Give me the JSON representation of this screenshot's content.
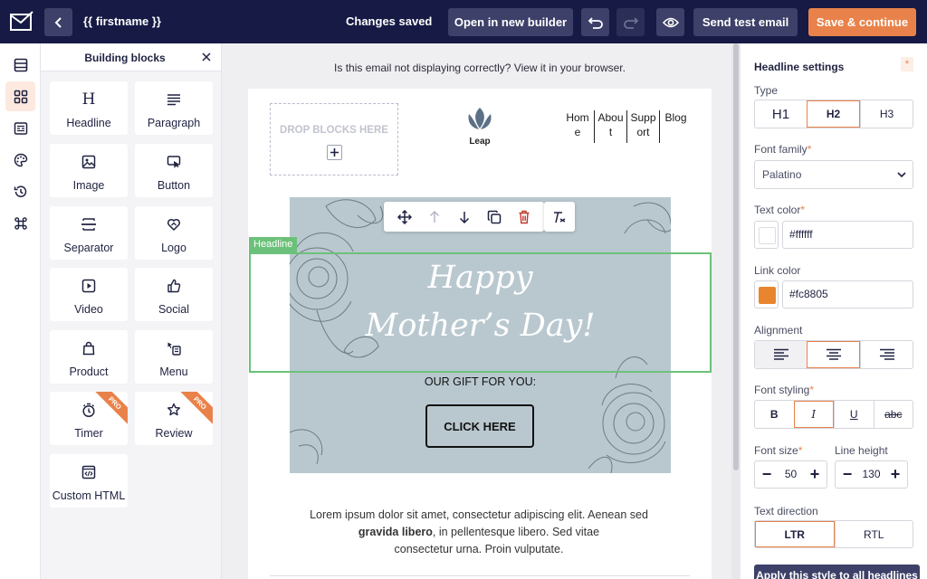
{
  "header": {
    "email_name": "{{ firstname }}",
    "status": "Changes saved",
    "open_builder": "Open in new builder",
    "send_test": "Send test email",
    "save_continue": "Save & continue"
  },
  "blocks_panel": {
    "title": "Building blocks",
    "items": [
      {
        "label": "Headline",
        "icon": "headline-icon"
      },
      {
        "label": "Paragraph",
        "icon": "paragraph-icon"
      },
      {
        "label": "Image",
        "icon": "image-icon"
      },
      {
        "label": "Button",
        "icon": "button-icon"
      },
      {
        "label": "Separator",
        "icon": "separator-icon"
      },
      {
        "label": "Logo",
        "icon": "logo-icon"
      },
      {
        "label": "Video",
        "icon": "video-icon"
      },
      {
        "label": "Social",
        "icon": "social-icon"
      },
      {
        "label": "Product",
        "icon": "product-icon"
      },
      {
        "label": "Menu",
        "icon": "menu-icon"
      },
      {
        "label": "Timer",
        "icon": "timer-icon",
        "badge": "PRO"
      },
      {
        "label": "Review",
        "icon": "review-icon",
        "badge": "PRO"
      },
      {
        "label": "Custom HTML",
        "icon": "code-icon"
      }
    ]
  },
  "canvas": {
    "browser_note": "Is this email not displaying correctly? View it in your browser.",
    "drop_text": "DROP BLOCKS HERE",
    "logo_text": "Leap",
    "nav": [
      "Home",
      "About",
      "Support",
      "Blog"
    ],
    "selection_tag": "Headline",
    "headline_line1": "Happy",
    "headline_line2": "Mother’s Day!",
    "gift_text": "OUR GIFT FOR YOU:",
    "cta": "CLICK HERE",
    "lorem_1": "Lorem ipsum dolor sit amet, consectetur adipiscing elit. Aenean sed",
    "lorem_bold": "gravida libero",
    "lorem_2": ", in pellentesque libero. Sed vitae",
    "lorem_3": "consectetur urna. Proin vulputate.",
    "hero_color": "#b9c8cf"
  },
  "settings": {
    "title": "Headline settings",
    "type_label": "Type",
    "types": [
      "H1",
      "H2",
      "H3"
    ],
    "type_selected": "H2",
    "font_family_label": "Font family",
    "font_family": "Palatino",
    "text_color_label": "Text color",
    "text_color": "#ffffff",
    "link_color_label": "Link color",
    "link_color": "#fc8805",
    "alignment_label": "Alignment",
    "alignment_selected": "center",
    "font_styling_label": "Font styling",
    "styling": [
      "B",
      "I",
      "U",
      "abc"
    ],
    "font_size_label": "Font size",
    "font_size": "50",
    "line_height_label": "Line height",
    "line_height": "130",
    "direction_label": "Text direction",
    "directions": [
      "LTR",
      "RTL"
    ],
    "direction_selected": "LTR",
    "apply_all": "Apply this style to all headlines",
    "accent": "#e9824a"
  }
}
